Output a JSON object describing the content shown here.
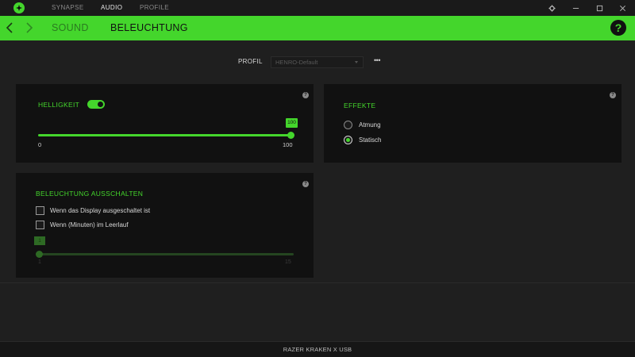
{
  "titlebar": {
    "nav": [
      {
        "label": "SYNAPSE"
      },
      {
        "label": "AUDIO"
      },
      {
        "label": "PROFILE"
      }
    ]
  },
  "header": {
    "tabs": [
      {
        "label": "SOUND"
      },
      {
        "label": "BELEUCHTUNG"
      }
    ],
    "help": "?"
  },
  "profile": {
    "label": "PROFIL",
    "selected": "HENRO-Default",
    "more": "•••"
  },
  "brightness": {
    "title": "HELLIGKEIT",
    "enabled": true,
    "value": "100",
    "min": "0",
    "max": "100"
  },
  "effects": {
    "title": "EFFEKTE",
    "options": [
      {
        "label": "Atmung",
        "selected": false
      },
      {
        "label": "Statisch",
        "selected": true
      }
    ]
  },
  "lighting_off": {
    "title": "BELEUCHTUNG AUSSCHALTEN",
    "options": [
      {
        "label": "Wenn das Display ausgeschaltet ist",
        "checked": false
      },
      {
        "label": "Wenn (Minuten) im Leerlauf",
        "checked": false
      }
    ],
    "idle_value": "1",
    "idle_min": "1",
    "idle_max": "15"
  },
  "panel_help": "?",
  "footer": {
    "device": "RAZER KRAKEN X USB"
  },
  "colors": {
    "accent": "#44d62c",
    "panel": "#111111",
    "background": "#1f1f1f"
  }
}
